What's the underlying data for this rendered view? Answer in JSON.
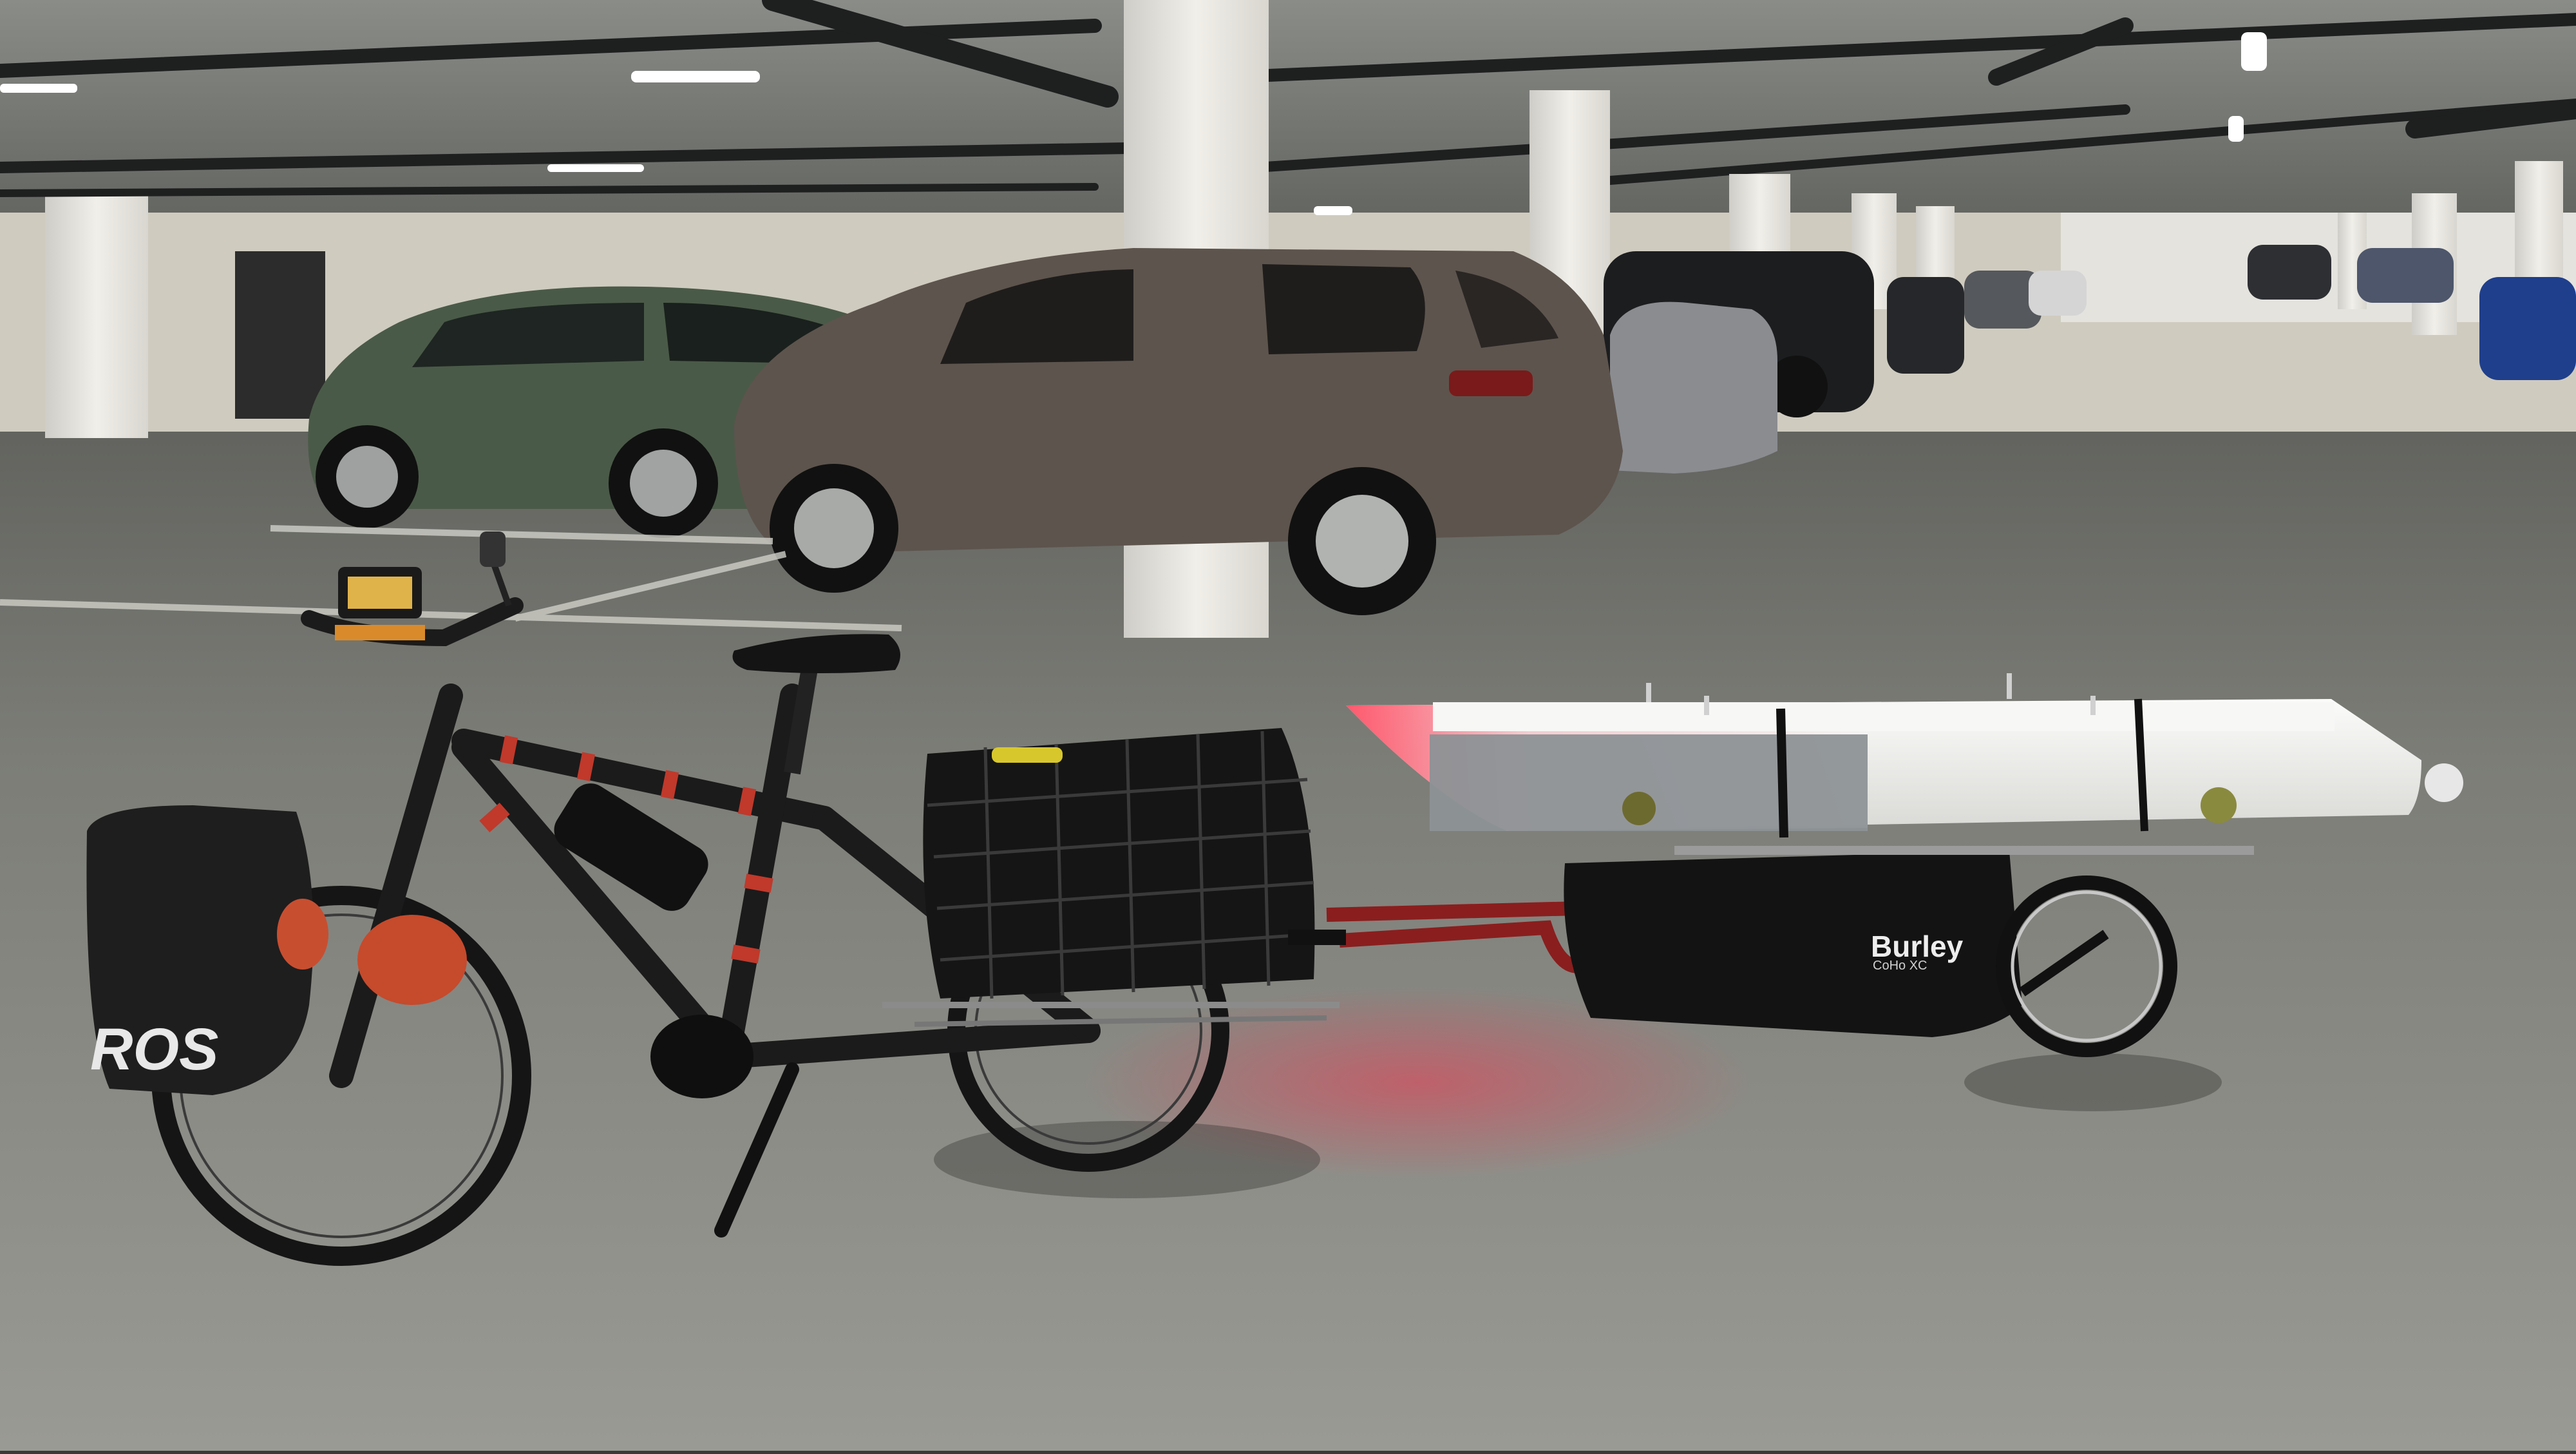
{
  "photo": {
    "subject": "Electric cargo bicycle towing a single-wheel trailer loaded with a white boat hull in an underground parking garage",
    "bag_text": "ROS",
    "trailer_brand": "Burley",
    "trailer_model": "CoHo XC",
    "colors": {
      "ceiling": "#6d706c",
      "floor": "#8e8f8a",
      "pillar": "#e8e6e0",
      "green_car": "#4e5e4c",
      "brown_suv": "#5c534c",
      "bike_frame": "#1b1b1b",
      "tape_red": "#c0392b",
      "hull": "#f2f2ef",
      "hull_tape": "#8d9296",
      "hull_bow_glow": "#ff4b5c"
    }
  }
}
